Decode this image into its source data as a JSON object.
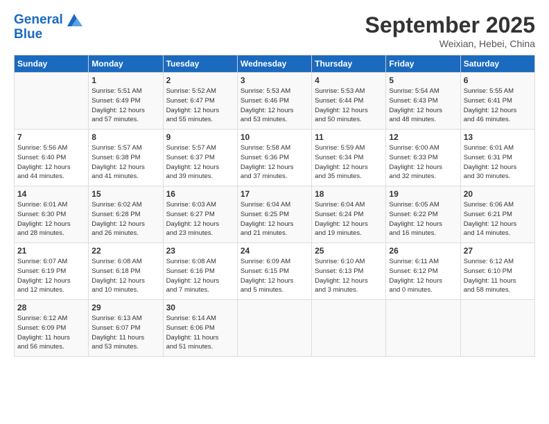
{
  "header": {
    "logo_line1": "General",
    "logo_line2": "Blue",
    "month": "September 2025",
    "location": "Weixian, Hebei, China"
  },
  "weekdays": [
    "Sunday",
    "Monday",
    "Tuesday",
    "Wednesday",
    "Thursday",
    "Friday",
    "Saturday"
  ],
  "weeks": [
    [
      {
        "day": "",
        "info": ""
      },
      {
        "day": "1",
        "info": "Sunrise: 5:51 AM\nSunset: 6:49 PM\nDaylight: 12 hours\nand 57 minutes."
      },
      {
        "day": "2",
        "info": "Sunrise: 5:52 AM\nSunset: 6:47 PM\nDaylight: 12 hours\nand 55 minutes."
      },
      {
        "day": "3",
        "info": "Sunrise: 5:53 AM\nSunset: 6:46 PM\nDaylight: 12 hours\nand 53 minutes."
      },
      {
        "day": "4",
        "info": "Sunrise: 5:53 AM\nSunset: 6:44 PM\nDaylight: 12 hours\nand 50 minutes."
      },
      {
        "day": "5",
        "info": "Sunrise: 5:54 AM\nSunset: 6:43 PM\nDaylight: 12 hours\nand 48 minutes."
      },
      {
        "day": "6",
        "info": "Sunrise: 5:55 AM\nSunset: 6:41 PM\nDaylight: 12 hours\nand 46 minutes."
      }
    ],
    [
      {
        "day": "7",
        "info": "Sunrise: 5:56 AM\nSunset: 6:40 PM\nDaylight: 12 hours\nand 44 minutes."
      },
      {
        "day": "8",
        "info": "Sunrise: 5:57 AM\nSunset: 6:38 PM\nDaylight: 12 hours\nand 41 minutes."
      },
      {
        "day": "9",
        "info": "Sunrise: 5:57 AM\nSunset: 6:37 PM\nDaylight: 12 hours\nand 39 minutes."
      },
      {
        "day": "10",
        "info": "Sunrise: 5:58 AM\nSunset: 6:36 PM\nDaylight: 12 hours\nand 37 minutes."
      },
      {
        "day": "11",
        "info": "Sunrise: 5:59 AM\nSunset: 6:34 PM\nDaylight: 12 hours\nand 35 minutes."
      },
      {
        "day": "12",
        "info": "Sunrise: 6:00 AM\nSunset: 6:33 PM\nDaylight: 12 hours\nand 32 minutes."
      },
      {
        "day": "13",
        "info": "Sunrise: 6:01 AM\nSunset: 6:31 PM\nDaylight: 12 hours\nand 30 minutes."
      }
    ],
    [
      {
        "day": "14",
        "info": "Sunrise: 6:01 AM\nSunset: 6:30 PM\nDaylight: 12 hours\nand 28 minutes."
      },
      {
        "day": "15",
        "info": "Sunrise: 6:02 AM\nSunset: 6:28 PM\nDaylight: 12 hours\nand 26 minutes."
      },
      {
        "day": "16",
        "info": "Sunrise: 6:03 AM\nSunset: 6:27 PM\nDaylight: 12 hours\nand 23 minutes."
      },
      {
        "day": "17",
        "info": "Sunrise: 6:04 AM\nSunset: 6:25 PM\nDaylight: 12 hours\nand 21 minutes."
      },
      {
        "day": "18",
        "info": "Sunrise: 6:04 AM\nSunset: 6:24 PM\nDaylight: 12 hours\nand 19 minutes."
      },
      {
        "day": "19",
        "info": "Sunrise: 6:05 AM\nSunset: 6:22 PM\nDaylight: 12 hours\nand 16 minutes."
      },
      {
        "day": "20",
        "info": "Sunrise: 6:06 AM\nSunset: 6:21 PM\nDaylight: 12 hours\nand 14 minutes."
      }
    ],
    [
      {
        "day": "21",
        "info": "Sunrise: 6:07 AM\nSunset: 6:19 PM\nDaylight: 12 hours\nand 12 minutes."
      },
      {
        "day": "22",
        "info": "Sunrise: 6:08 AM\nSunset: 6:18 PM\nDaylight: 12 hours\nand 10 minutes."
      },
      {
        "day": "23",
        "info": "Sunrise: 6:08 AM\nSunset: 6:16 PM\nDaylight: 12 hours\nand 7 minutes."
      },
      {
        "day": "24",
        "info": "Sunrise: 6:09 AM\nSunset: 6:15 PM\nDaylight: 12 hours\nand 5 minutes."
      },
      {
        "day": "25",
        "info": "Sunrise: 6:10 AM\nSunset: 6:13 PM\nDaylight: 12 hours\nand 3 minutes."
      },
      {
        "day": "26",
        "info": "Sunrise: 6:11 AM\nSunset: 6:12 PM\nDaylight: 12 hours\nand 0 minutes."
      },
      {
        "day": "27",
        "info": "Sunrise: 6:12 AM\nSunset: 6:10 PM\nDaylight: 11 hours\nand 58 minutes."
      }
    ],
    [
      {
        "day": "28",
        "info": "Sunrise: 6:12 AM\nSunset: 6:09 PM\nDaylight: 11 hours\nand 56 minutes."
      },
      {
        "day": "29",
        "info": "Sunrise: 6:13 AM\nSunset: 6:07 PM\nDaylight: 11 hours\nand 53 minutes."
      },
      {
        "day": "30",
        "info": "Sunrise: 6:14 AM\nSunset: 6:06 PM\nDaylight: 11 hours\nand 51 minutes."
      },
      {
        "day": "",
        "info": ""
      },
      {
        "day": "",
        "info": ""
      },
      {
        "day": "",
        "info": ""
      },
      {
        "day": "",
        "info": ""
      }
    ]
  ]
}
